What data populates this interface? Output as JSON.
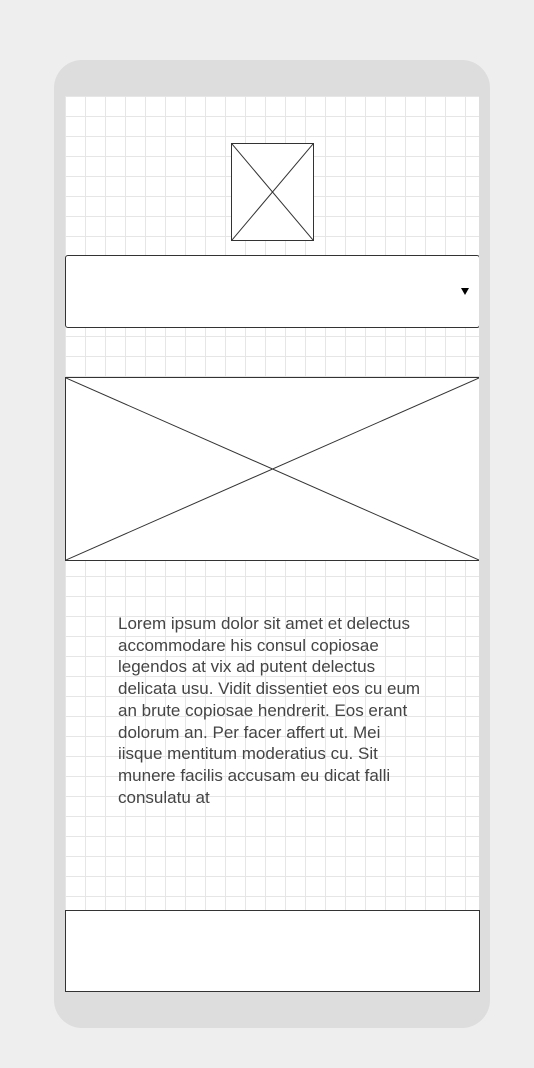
{
  "screen": {
    "dropdown": {
      "selected_value": ""
    },
    "body_text": "Lorem ipsum dolor sit amet et delectus accommodare his consul copiosae legendos at vix ad putent delectus delicata usu. Vidit dissentiet eos cu eum an brute copiosae hendrerit. Eos erant dolorum an. Per facer affert ut. Mei iisque mentitum moderatius cu. Sit munere facilis accusam eu dicat falli consulatu at"
  },
  "icons": {
    "small_image": "image-placeholder-icon",
    "large_image": "image-placeholder-icon",
    "dropdown_caret": "caret-down-icon"
  },
  "colors": {
    "device_frame": "#dddddd",
    "page_background": "#eeeeee",
    "grid_line": "#e6e6e6",
    "outline": "#333333",
    "text": "#444444"
  }
}
